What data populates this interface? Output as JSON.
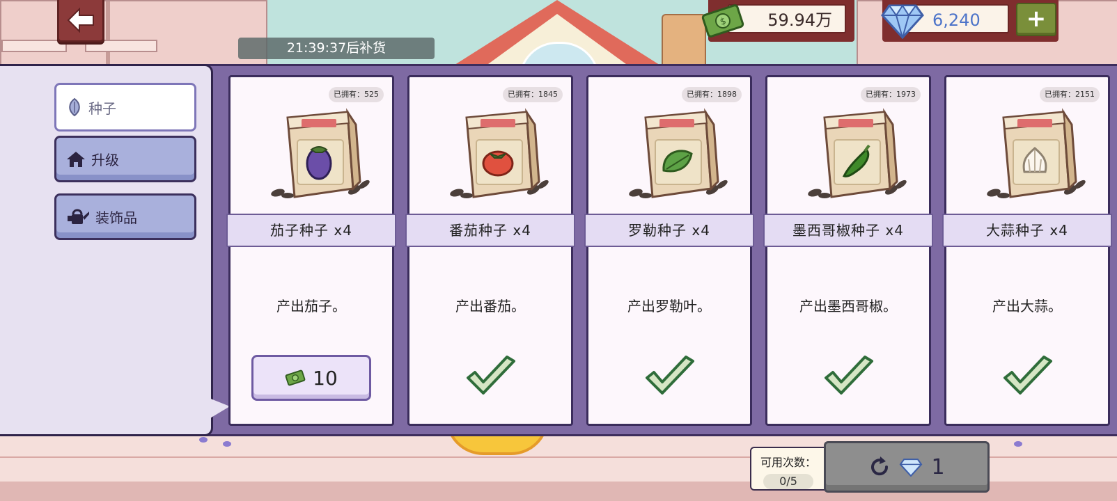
{
  "hud": {
    "money": "59.94万",
    "gems": "6,240",
    "add_label": "+",
    "restock_timer": "21:39:37后补货"
  },
  "sidebar": {
    "tabs": [
      {
        "label": "种子",
        "icon": "seed-icon",
        "active": true
      },
      {
        "label": "升级",
        "icon": "house-icon",
        "active": false
      },
      {
        "label": "装饰品",
        "icon": "watering-can-icon",
        "active": false
      }
    ]
  },
  "products": [
    {
      "owned": "已拥有：525",
      "name": "茄子种子 x4",
      "desc": "产出茄子。",
      "produce": "eggplant",
      "price": "10",
      "purchased": false
    },
    {
      "owned": "已拥有：1845",
      "name": "番茄种子 x4",
      "desc": "产出番茄。",
      "produce": "tomato",
      "purchased": true
    },
    {
      "owned": "已拥有：1898",
      "name": "罗勒种子 x4",
      "desc": "产出罗勒叶。",
      "produce": "basil",
      "purchased": true
    },
    {
      "owned": "已拥有：1973",
      "name": "墨西哥椒种子 x4",
      "desc": "产出墨西哥椒。",
      "produce": "jalapeno",
      "purchased": true
    },
    {
      "owned": "已拥有：2151",
      "name": "大蒜种子 x4",
      "desc": "产出大蒜。",
      "produce": "garlic",
      "purchased": true
    }
  ],
  "refresh": {
    "label": "可用次数：",
    "count": "0/5",
    "cost": "1"
  },
  "colors": {
    "panel_purple": "#7e6aa3",
    "card_bg": "#fdf7fc",
    "money_green": "#5e8f3c",
    "gem_blue": "#4d74c9",
    "check_green": "#2f6d3a"
  }
}
